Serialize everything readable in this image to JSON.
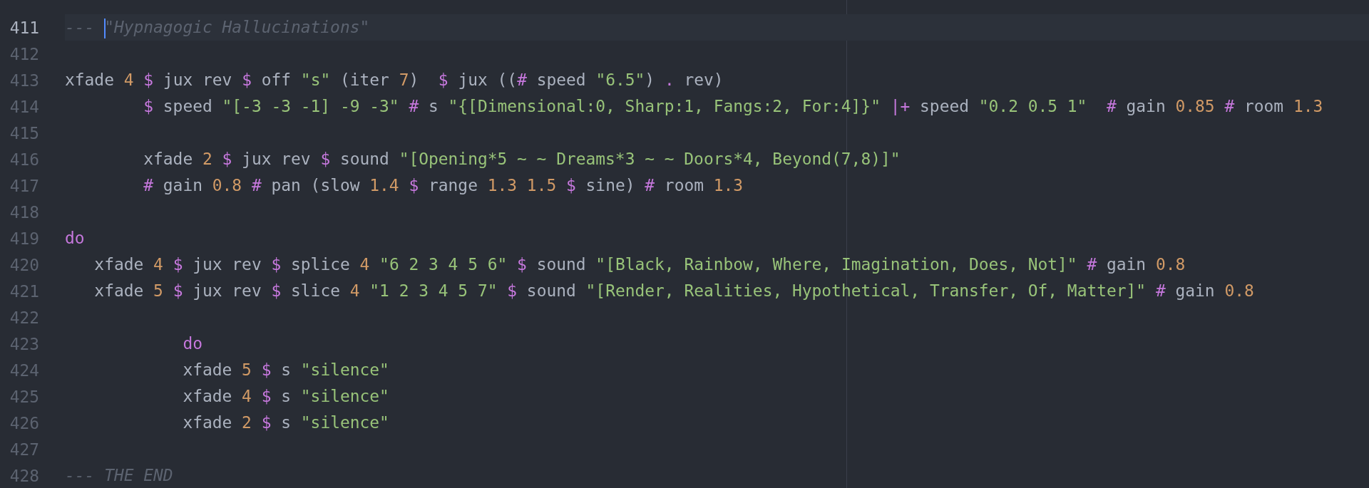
{
  "editor": {
    "lines": [
      {
        "number": "411",
        "active": true,
        "tokens": [
          {
            "kind": "comment",
            "text": "--- "
          },
          {
            "kind": "comment",
            "text": "\"Hypnagogic Hallucinations\"",
            "caret_before": true
          }
        ]
      },
      {
        "number": "412",
        "active": false
      },
      {
        "number": "413",
        "active": false,
        "tokens": [
          {
            "kind": "plain",
            "text": "xfade "
          },
          {
            "kind": "number",
            "text": "4"
          },
          {
            "kind": "keyword",
            "text": " $"
          },
          {
            "kind": "plain",
            "text": " jux rev "
          },
          {
            "kind": "keyword",
            "text": "$"
          },
          {
            "kind": "plain",
            "text": " off "
          },
          {
            "kind": "string",
            "text": "\"s\""
          },
          {
            "kind": "plain",
            "text": " (iter "
          },
          {
            "kind": "number",
            "text": "7"
          },
          {
            "kind": "plain",
            "text": ")  "
          },
          {
            "kind": "keyword",
            "text": "$"
          },
          {
            "kind": "plain",
            "text": " jux (("
          },
          {
            "kind": "keyword",
            "text": "#"
          },
          {
            "kind": "plain",
            "text": " speed "
          },
          {
            "kind": "string",
            "text": "\"6.5\""
          },
          {
            "kind": "plain",
            "text": ") "
          },
          {
            "kind": "keyword",
            "text": "."
          },
          {
            "kind": "plain",
            "text": " rev)"
          }
        ]
      },
      {
        "number": "414",
        "active": false,
        "tokens": [
          {
            "kind": "keyword",
            "text": "        $"
          },
          {
            "kind": "plain",
            "text": " speed "
          },
          {
            "kind": "string",
            "text": "\"[-3 -3 -1] -9 -3\""
          },
          {
            "kind": "keyword",
            "text": " #"
          },
          {
            "kind": "plain",
            "text": " s "
          },
          {
            "kind": "string",
            "text": "\"{[Dimensional:0, Sharp:1, Fangs:2, For:4]}\""
          },
          {
            "kind": "keyword",
            "text": " |+"
          },
          {
            "kind": "plain",
            "text": " speed "
          },
          {
            "kind": "string",
            "text": "\"0.2 0.5 1\""
          },
          {
            "kind": "keyword",
            "text": "  #"
          },
          {
            "kind": "plain",
            "text": " gain "
          },
          {
            "kind": "number",
            "text": "0.85"
          },
          {
            "kind": "keyword",
            "text": " #"
          },
          {
            "kind": "plain",
            "text": " room "
          },
          {
            "kind": "number",
            "text": "1.3"
          }
        ]
      },
      {
        "number": "415",
        "active": false
      },
      {
        "number": "416",
        "active": false,
        "tokens": [
          {
            "kind": "plain",
            "text": "        xfade "
          },
          {
            "kind": "number",
            "text": "2"
          },
          {
            "kind": "keyword",
            "text": " $"
          },
          {
            "kind": "plain",
            "text": " jux rev "
          },
          {
            "kind": "keyword",
            "text": "$"
          },
          {
            "kind": "plain",
            "text": " sound "
          },
          {
            "kind": "string",
            "text": "\"[Opening*5 ~ ~ Dreams*3 ~ ~ Doors*4, Beyond(7,8)]\""
          }
        ]
      },
      {
        "number": "417",
        "active": false,
        "tokens": [
          {
            "kind": "keyword",
            "text": "        #"
          },
          {
            "kind": "plain",
            "text": " gain "
          },
          {
            "kind": "number",
            "text": "0.8"
          },
          {
            "kind": "keyword",
            "text": " #"
          },
          {
            "kind": "plain",
            "text": " pan (slow "
          },
          {
            "kind": "number",
            "text": "1.4"
          },
          {
            "kind": "keyword",
            "text": " $"
          },
          {
            "kind": "plain",
            "text": " range "
          },
          {
            "kind": "number",
            "text": "1.3 1.5"
          },
          {
            "kind": "keyword",
            "text": " $"
          },
          {
            "kind": "plain",
            "text": " sine) "
          },
          {
            "kind": "keyword",
            "text": "#"
          },
          {
            "kind": "plain",
            "text": " room "
          },
          {
            "kind": "number",
            "text": "1.3"
          }
        ]
      },
      {
        "number": "418",
        "active": false
      },
      {
        "number": "419",
        "active": false,
        "tokens": [
          {
            "kind": "keyword",
            "text": "do"
          }
        ]
      },
      {
        "number": "420",
        "active": false,
        "tokens": [
          {
            "kind": "plain",
            "text": "   xfade "
          },
          {
            "kind": "number",
            "text": "4"
          },
          {
            "kind": "keyword",
            "text": " $"
          },
          {
            "kind": "plain",
            "text": " jux rev "
          },
          {
            "kind": "keyword",
            "text": "$"
          },
          {
            "kind": "plain",
            "text": " splice "
          },
          {
            "kind": "number",
            "text": "4"
          },
          {
            "kind": "string",
            "text": " \"6 2 3 4 5 6\""
          },
          {
            "kind": "keyword",
            "text": " $"
          },
          {
            "kind": "plain",
            "text": " sound "
          },
          {
            "kind": "string",
            "text": "\"[Black, Rainbow, Where, Imagination, Does, Not]\""
          },
          {
            "kind": "keyword",
            "text": " #"
          },
          {
            "kind": "plain",
            "text": " gain "
          },
          {
            "kind": "number",
            "text": "0.8"
          }
        ]
      },
      {
        "number": "421",
        "active": false,
        "tokens": [
          {
            "kind": "plain",
            "text": "   xfade "
          },
          {
            "kind": "number",
            "text": "5"
          },
          {
            "kind": "keyword",
            "text": " $"
          },
          {
            "kind": "plain",
            "text": " jux rev "
          },
          {
            "kind": "keyword",
            "text": "$"
          },
          {
            "kind": "plain",
            "text": " slice "
          },
          {
            "kind": "number",
            "text": "4"
          },
          {
            "kind": "string",
            "text": " \"1 2 3 4 5 7\""
          },
          {
            "kind": "keyword",
            "text": " $"
          },
          {
            "kind": "plain",
            "text": " sound "
          },
          {
            "kind": "string",
            "text": "\"[Render, Realities, Hypothetical, Transfer, Of, Matter]\""
          },
          {
            "kind": "keyword",
            "text": " #"
          },
          {
            "kind": "plain",
            "text": " gain "
          },
          {
            "kind": "number",
            "text": "0.8"
          }
        ]
      },
      {
        "number": "422",
        "active": false
      },
      {
        "number": "423",
        "active": false,
        "tokens": [
          {
            "kind": "keyword",
            "text": "            do"
          }
        ]
      },
      {
        "number": "424",
        "active": false,
        "tokens": [
          {
            "kind": "plain",
            "text": "            xfade "
          },
          {
            "kind": "number",
            "text": "5"
          },
          {
            "kind": "keyword",
            "text": " $"
          },
          {
            "kind": "plain",
            "text": " s "
          },
          {
            "kind": "string",
            "text": "\"silence\""
          }
        ]
      },
      {
        "number": "425",
        "active": false,
        "tokens": [
          {
            "kind": "plain",
            "text": "            xfade "
          },
          {
            "kind": "number",
            "text": "4"
          },
          {
            "kind": "keyword",
            "text": " $"
          },
          {
            "kind": "plain",
            "text": " s "
          },
          {
            "kind": "string",
            "text": "\"silence\""
          }
        ]
      },
      {
        "number": "426",
        "active": false,
        "tokens": [
          {
            "kind": "plain",
            "text": "            xfade "
          },
          {
            "kind": "number",
            "text": "2"
          },
          {
            "kind": "keyword",
            "text": " $"
          },
          {
            "kind": "plain",
            "text": " s "
          },
          {
            "kind": "string",
            "text": "\"silence\""
          }
        ]
      },
      {
        "number": "427",
        "active": false
      },
      {
        "number": "428",
        "active": false,
        "tokens": [
          {
            "kind": "comment",
            "text": "--- THE END"
          }
        ]
      }
    ]
  }
}
